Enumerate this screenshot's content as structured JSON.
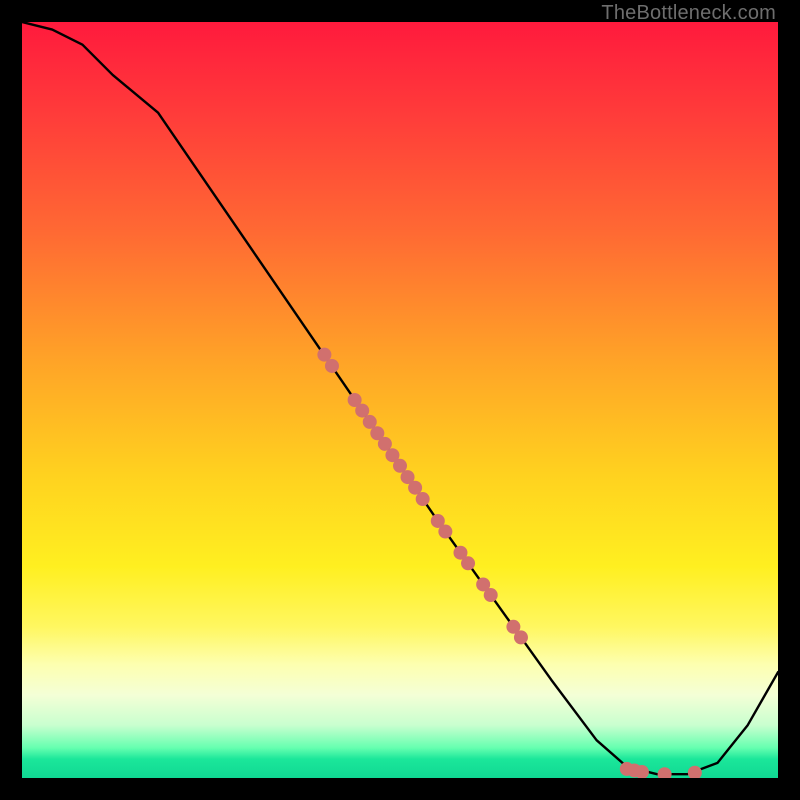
{
  "watermark": "TheBottleneck.com",
  "chart_data": {
    "type": "line",
    "title": "",
    "xlabel": "",
    "ylabel": "",
    "xlim": [
      0,
      100
    ],
    "ylim": [
      0,
      100
    ],
    "grid": false,
    "legend": false,
    "series": [
      {
        "name": "curve",
        "color": "#000000",
        "x": [
          0,
          4,
          8,
          12,
          18,
          55,
          70,
          76,
          80,
          84,
          88,
          92,
          96,
          100
        ],
        "y": [
          100,
          99,
          97,
          93,
          88,
          34,
          13,
          5,
          1.5,
          0.5,
          0.5,
          2,
          7,
          14
        ]
      }
    ],
    "scatter": {
      "name": "points-on-curve",
      "color": "#d1706e",
      "radius": 7,
      "points": [
        {
          "x": 40,
          "y": 56.0
        },
        {
          "x": 41,
          "y": 54.5
        },
        {
          "x": 44,
          "y": 50.0
        },
        {
          "x": 45,
          "y": 48.6
        },
        {
          "x": 46,
          "y": 47.1
        },
        {
          "x": 47,
          "y": 45.6
        },
        {
          "x": 48,
          "y": 44.2
        },
        {
          "x": 49,
          "y": 42.7
        },
        {
          "x": 50,
          "y": 41.3
        },
        {
          "x": 51,
          "y": 39.8
        },
        {
          "x": 52,
          "y": 38.4
        },
        {
          "x": 53,
          "y": 36.9
        },
        {
          "x": 55,
          "y": 34.0
        },
        {
          "x": 56,
          "y": 32.6
        },
        {
          "x": 58,
          "y": 29.8
        },
        {
          "x": 59,
          "y": 28.4
        },
        {
          "x": 61,
          "y": 25.6
        },
        {
          "x": 62,
          "y": 24.2
        },
        {
          "x": 65,
          "y": 20.0
        },
        {
          "x": 66,
          "y": 18.6
        },
        {
          "x": 80,
          "y": 1.2
        },
        {
          "x": 81,
          "y": 1.0
        },
        {
          "x": 82,
          "y": 0.8
        },
        {
          "x": 85,
          "y": 0.5
        },
        {
          "x": 89,
          "y": 0.7
        }
      ]
    }
  }
}
